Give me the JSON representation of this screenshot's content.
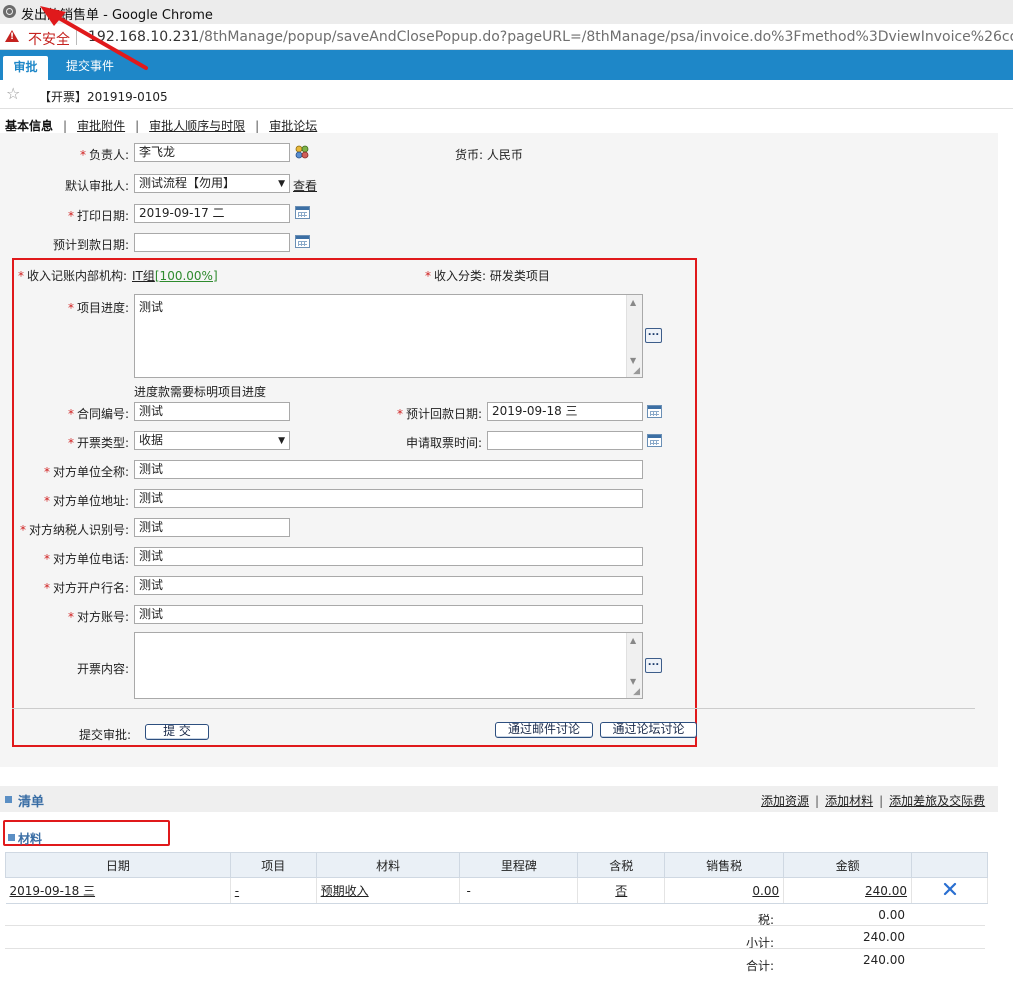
{
  "window": {
    "title": "发出的销售单 - Google Chrome"
  },
  "urlbar": {
    "security_label": "不安全",
    "host": "192.168.10.231",
    "path": "/8thManage/popup/saveAndClosePopup.do?pageURL=/8thManage/psa/invoice.do%3Fmethod%3DviewInvoice%26compa"
  },
  "tabs": [
    {
      "label": "审批"
    },
    {
      "label": "提交事件"
    }
  ],
  "header": {
    "doc_title": "【开票】201919-0105"
  },
  "subnav": [
    {
      "label": "基本信息"
    },
    {
      "label": "审批附件"
    },
    {
      "label": "审批人顺序与时限"
    },
    {
      "label": "审批论坛"
    }
  ],
  "form": {
    "owner_label": "负责人:",
    "owner_value": "李飞龙",
    "currency_label": "货币:",
    "currency_value": "人民币",
    "approver_label": "默认审批人:",
    "approver_value": "测试流程【勿用】",
    "approver_view_link": "查看",
    "print_date_label": "打印日期:",
    "print_date_value": "2019-09-17 二",
    "expected_pay_label": "预计到款日期:",
    "expected_pay_value": "",
    "dept_label": "收入记账内部机构:",
    "dept_value": "IT组",
    "dept_percent": "[100.00%]",
    "income_type_label": "收入分类:",
    "income_type_value": "研发类项目",
    "progress_label": "项目进度:",
    "progress_value": "测试",
    "progress_hint": "进度款需要标明项目进度",
    "contract_no_label": "合同编号:",
    "contract_no_value": "测试",
    "expected_return_label": "预计回款日期:",
    "expected_return_value": "2019-09-18 三",
    "invoice_type_label": "开票类型:",
    "invoice_type_value": "收据",
    "pickup_time_label": "申请取票时间:",
    "pickup_time_value": "",
    "party_name_label": "对方单位全称:",
    "party_name_value": "测试",
    "party_addr_label": "对方单位地址:",
    "party_addr_value": "测试",
    "party_taxid_label": "对方纳税人识别号:",
    "party_taxid_value": "测试",
    "party_phone_label": "对方单位电话:",
    "party_phone_value": "测试",
    "party_bank_label": "对方开户行名:",
    "party_bank_value": "测试",
    "party_account_label": "对方账号:",
    "party_account_value": "测试",
    "invoice_content_label": "开票内容:",
    "invoice_content_value": "",
    "submit_label": "提交审批:",
    "submit_button": "提 交",
    "email_discuss_button": "通过邮件讨论",
    "forum_discuss_button": "通过论坛讨论"
  },
  "list": {
    "title": "清单",
    "actions": [
      "添加资源",
      "添加材料",
      "添加差旅及交际费"
    ],
    "materials_title": "材料",
    "columns": [
      "日期",
      "项目",
      "材料",
      "里程碑",
      "含税",
      "销售税",
      "金额"
    ],
    "rows": [
      {
        "date": "2019-09-18 三",
        "project": "-",
        "material": "预期收入",
        "milestone": "-",
        "tax_included": "否",
        "sales_tax": "0.00",
        "amount": "240.00"
      }
    ],
    "summary": [
      {
        "label": "税:",
        "value": "0.00"
      },
      {
        "label": "小计:",
        "value": "240.00"
      },
      {
        "label": "合计:",
        "value": "240.00"
      }
    ]
  },
  "colors": {
    "tab_bar": "#1e87c8",
    "annotation_red": "#e0191b",
    "accent_blue": "#3a6ea5"
  },
  "icons": [
    "globe-icon",
    "warning-icon",
    "star-icon",
    "user-picker-icon",
    "calendar-icon",
    "ellipsis-icon",
    "delete-x-icon"
  ]
}
